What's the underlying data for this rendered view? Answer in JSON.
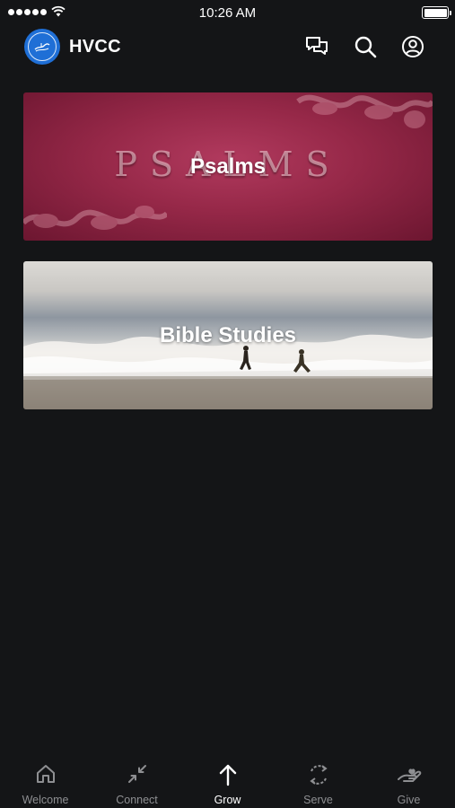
{
  "status_bar": {
    "time": "10:26 AM"
  },
  "header": {
    "title": "HVCC",
    "icons": [
      "chat-icon",
      "search-icon",
      "profile-icon"
    ]
  },
  "cards": [
    {
      "label": "Psalms",
      "background_text": "PSALMS"
    },
    {
      "label": "Bible Studies"
    }
  ],
  "tabs": [
    {
      "label": "Welcome",
      "icon": "home-icon",
      "active": false
    },
    {
      "label": "Connect",
      "icon": "connect-arrows-icon",
      "active": false
    },
    {
      "label": "Grow",
      "icon": "arrow-up-icon",
      "active": true
    },
    {
      "label": "Serve",
      "icon": "refresh-icon",
      "active": false
    },
    {
      "label": "Give",
      "icon": "giving-hand-icon",
      "active": false
    }
  ],
  "colors": {
    "background": "#141517",
    "brand": "#1f6fd6",
    "tab_inactive": "#8e8f92",
    "tab_active": "#ffffff"
  }
}
